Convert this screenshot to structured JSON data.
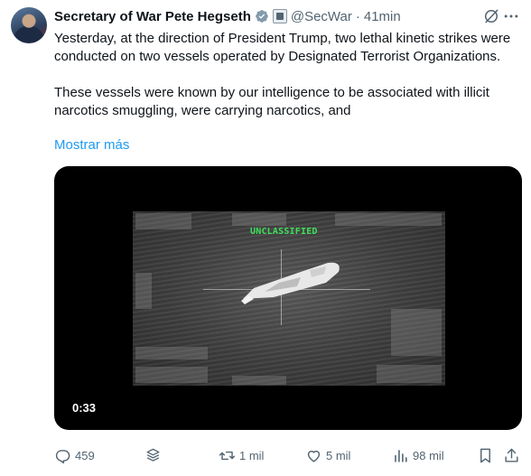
{
  "author": {
    "name": "Secretary of War Pete Hegseth",
    "handle": "@SecWar",
    "separator": "·",
    "time": "41min"
  },
  "tweet": {
    "paragraph1": "Yesterday, at the direction of President Trump, two lethal kinetic strikes were conducted on two vessels operated by Designated Terrorist Organizations.",
    "paragraph2": "These vessels were known by our intelligence to be associated with illicit narcotics smuggling, were carrying narcotics, and",
    "show_more": "Mostrar más"
  },
  "media": {
    "overlay_label": "UNCLASSIFIED",
    "duration": "0:33"
  },
  "actions": {
    "replies": "459",
    "reposts": "1 mil",
    "likes": "5 mil",
    "views": "98 mil"
  },
  "colors": {
    "accent": "#1d9bf0",
    "muted": "#536471",
    "verified_badge": "#829aab",
    "overlay_green": "#3fe05a"
  },
  "icons": [
    "avatar",
    "verified-badge-icon",
    "government-badge-icon",
    "grok-icon",
    "more-icon",
    "reply-icon",
    "grok-stack-icon",
    "repost-icon",
    "like-icon",
    "views-icon",
    "bookmark-icon",
    "share-icon"
  ]
}
